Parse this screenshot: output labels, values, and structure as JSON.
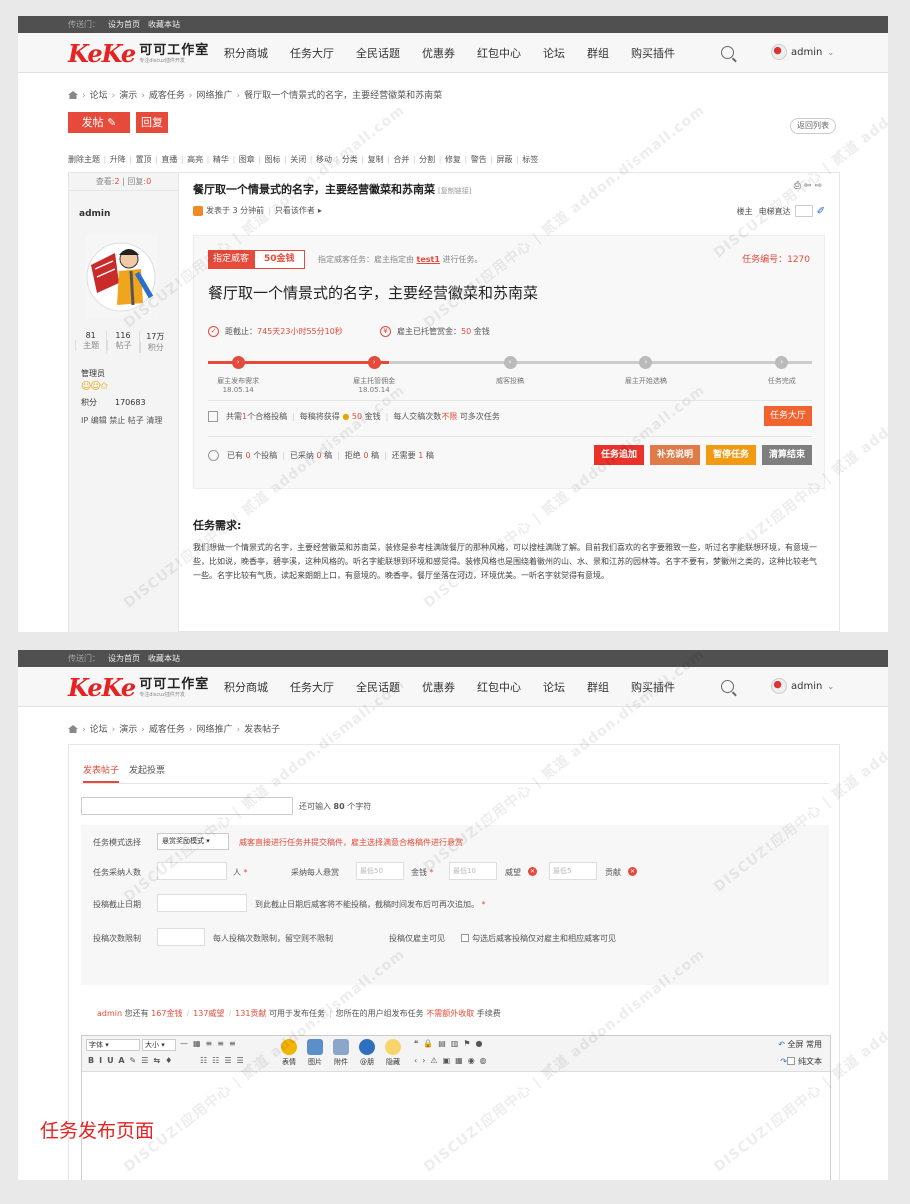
{
  "topbar": {
    "prefix": "传送门：",
    "set_home": "设为首页",
    "bookmark": "收藏本站"
  },
  "logo": {
    "mark": "KeKe",
    "name": "可可工作室",
    "slogan": "专注discuz插件开发"
  },
  "nav": {
    "items": [
      "积分商城",
      "任务大厅",
      "全民话题",
      "优惠券",
      "红包中心",
      "论坛",
      "群组",
      "购买插件"
    ],
    "user": "admin"
  },
  "screen1": {
    "breadcrumb": [
      "论坛",
      "演示",
      "威客任务",
      "网络推广",
      "餐厅取一个情景式的名字，主要经营徽菜和苏南菜"
    ],
    "post_button": "发帖",
    "reply_button": "回复",
    "back_button": "返回列表",
    "mod_tools": [
      "删除主题",
      "升降",
      "置顶",
      "直播",
      "高亮",
      "精华",
      "图章",
      "图标",
      "关闭",
      "移动",
      "分类",
      "复制",
      "合并",
      "分割",
      "修复",
      "警告",
      "屏蔽",
      "标签"
    ],
    "stats": {
      "view_label": "查看:",
      "views": "2",
      "reply_label": "回复:",
      "replies": "0"
    },
    "author": {
      "name": "admin",
      "threads": "81",
      "threads_label": "主题",
      "posts": "116",
      "posts_label": "帖子",
      "credits": "17万",
      "credits_label": "积分",
      "group": "管理员",
      "score_label": "积分",
      "score": "170683",
      "ops": "IP 编辑 禁止 帖子 清理"
    },
    "thread_title": "餐厅取一个情景式的名字，主要经营徽菜和苏南菜",
    "copy_link": "[复制链接]",
    "posted": "发表于 3 分钟前",
    "only_author": "只看该作者",
    "floor": {
      "label": "楼主",
      "jump": "电梯直达"
    },
    "task": {
      "badge": "指定威客",
      "reward": "50金钱",
      "designate_prefix": "指定威客任务：雇主指定由",
      "designate_user": "test1",
      "designate_suffix": "进行任务。",
      "number_label": "任务编号：",
      "number": "1270",
      "name": "餐厅取一个情景式的名字，主要经营徽菜和苏南菜",
      "deadline_label": "距截止：",
      "deadline": "745天23小时55分10秒",
      "trusted_label": "雇主已托管赏金：",
      "trusted_value": "50",
      "trusted_unit": "金钱",
      "steps": [
        {
          "label": "雇主发布需求",
          "date": "18.05.14",
          "done": true
        },
        {
          "label": "雇主托管佣金",
          "date": "18.05.14",
          "done": true
        },
        {
          "label": "威客投稿",
          "date": "",
          "done": false
        },
        {
          "label": "雇主开始选稿",
          "date": "",
          "done": false
        },
        {
          "label": "任务完成",
          "date": "",
          "done": false
        }
      ],
      "progress_fraction": 0.3,
      "summary": {
        "p1": "共需",
        "need": "1",
        "p2": "个合格投稿",
        "p3": "每稿将获得",
        "each": "50",
        "p4": "金钱",
        "p5": "每人交稿次数",
        "limit": "不限",
        "p6": "可多次任务"
      },
      "hall_button": "任务大厅",
      "counts": {
        "has": "已有",
        "submitted": "0",
        "submitted_unit": "个投稿",
        "adopted_label": "已采纳",
        "adopted": "0",
        "adopted_unit": "稿",
        "rejected_label": "拒绝",
        "rejected": "0",
        "rejected_unit": "稿",
        "need_label": "还需要",
        "need": "1",
        "need_unit": "稿"
      },
      "actions": [
        {
          "label": "任务追加",
          "color": "#e8322a"
        },
        {
          "label": "补充说明",
          "color": "#e07b48"
        },
        {
          "label": "暂停任务",
          "color": "#f29a12"
        },
        {
          "label": "清算结束",
          "color": "#7f7f7f"
        }
      ]
    },
    "requirements_title": "任务需求:",
    "requirements_text": "我们想做一个情景式的名字，主要经营徽菜和苏南菜，装修是参考桂满陇餐厅的那种风格，可以搜桂满陇了解。目前我们喜欢的名字要雅致一些，听过名字能联想环境，有意境一些，比如说，晚香亭，碧亭溪，这种风格的。听名字能联想到环境和感觉得。装修风格也是围绕着徽州的山、水、景和江苏的园林等。名字不要有，梦徽州之类的，这种比较老气一些。名字比较有气质，读起来朗朗上口，有意境的。晚香亭，餐厅坐落在河边，环境优美。一听名字就觉得有意境。"
  },
  "screen2": {
    "breadcrumb": [
      "论坛",
      "演示",
      "威客任务",
      "网络推广",
      "发表帖子"
    ],
    "tabs": [
      "发表帖子",
      "发起投票"
    ],
    "remain_prefix": "还可输入",
    "remain_count": "80",
    "remain_suffix": "个字符",
    "mode_label": "任务模式选择",
    "mode_value": "悬赏奖励模式",
    "mode_note": "威客直接进行任务并提交稿件，雇主选择满意合格稿件进行悬赏",
    "adopt_label": "任务采纳人数",
    "adopt_unit": "人",
    "reward_label": "采纳每人悬赏",
    "reward_money_ph": "最低50",
    "reward_money_unit": "金钱",
    "reward_fame_ph": "最低10",
    "reward_fame_unit": "威望",
    "reward_contrib_ph": "最低5",
    "reward_contrib_unit": "贡献",
    "deadline_label": "投稿截止日期",
    "deadline_note": "到此截止日期后威客将不能投稿，截稿时间发布后可再次追加。",
    "limit_label": "投稿次数限制",
    "limit_note": "每人投稿次数限制，留空则不限制",
    "visible_label": "投稿仅雇主可见",
    "visible_note": "勾选后威客投稿仅对雇主和相应威客可见",
    "ledger": {
      "user": "admin",
      "p1": "您还有",
      "money": "167金钱",
      "fame": "137威望",
      "contrib": "131贡献",
      "p2": "可用于发布任务",
      "p3": "您所在的用户组发布任务",
      "free": "不需额外收取",
      "p4": "手续费"
    },
    "editor": {
      "font": "字体",
      "size": "大小",
      "tools": [
        "表情",
        "图片",
        "附件",
        "@朋",
        "隐藏"
      ],
      "fullscreen": "全屏",
      "common": "常用",
      "plain": "纯文本"
    },
    "caption": "任务发布页面"
  },
  "watermark": "DISCUZ!应用中心 | 贰道 addon.dismall.com",
  "colors": {
    "accent": "#e64a3a",
    "topbar": "#505050"
  }
}
